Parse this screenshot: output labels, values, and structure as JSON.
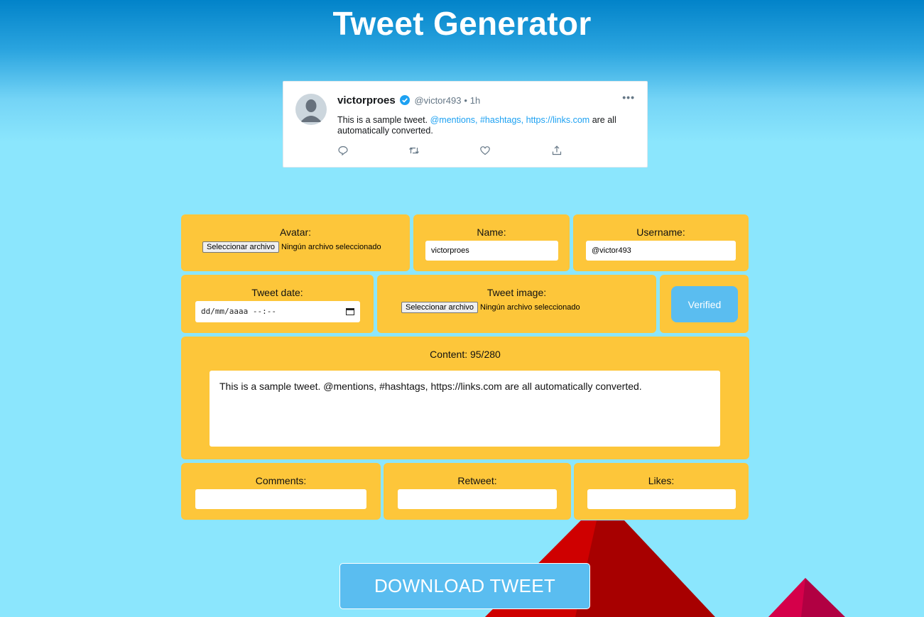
{
  "page": {
    "title": "Tweet Generator"
  },
  "tweet_preview": {
    "name": "victorproes",
    "handle": "@victor493",
    "separator": "•",
    "time": "1h",
    "more_icon": "more-dots-icon",
    "body_plain_start": "This is a sample tweet. ",
    "body_links": "@mentions, #hashtags, https://links.com",
    "body_plain_end": " are all automatically converted.",
    "actions": [
      "reply-icon",
      "retweet-icon",
      "like-icon",
      "share-icon"
    ]
  },
  "form": {
    "avatar": {
      "label": "Avatar:",
      "button": "Seleccionar archivo",
      "status": "Ningún archivo seleccionado"
    },
    "name": {
      "label": "Name:",
      "value": "victorproes"
    },
    "username": {
      "label": "Username:",
      "value": "@victor493"
    },
    "tweet_date": {
      "label": "Tweet date:",
      "placeholder": "dd/mm/aaaa --:--"
    },
    "tweet_image": {
      "label": "Tweet image:",
      "button": "Seleccionar archivo",
      "status": "Ningún archivo seleccionado"
    },
    "verified": {
      "label": "Verified"
    },
    "content": {
      "label": "Content: 95/280",
      "value": "This is a sample tweet. @mentions, #hashtags, https://links.com are all automatically converted."
    },
    "comments": {
      "label": "Comments:",
      "value": ""
    },
    "retweet": {
      "label": "Retweet:",
      "value": ""
    },
    "likes": {
      "label": "Likes:",
      "value": ""
    }
  },
  "download_button": {
    "label": "DOWNLOAD TWEET"
  },
  "colors": {
    "panel": "#fdc63a",
    "background": "#8be6fd",
    "header_top": "#0283c9",
    "button": "#5abdf0",
    "link": "#1da1f2",
    "verified_badge": "#1da1f2"
  }
}
